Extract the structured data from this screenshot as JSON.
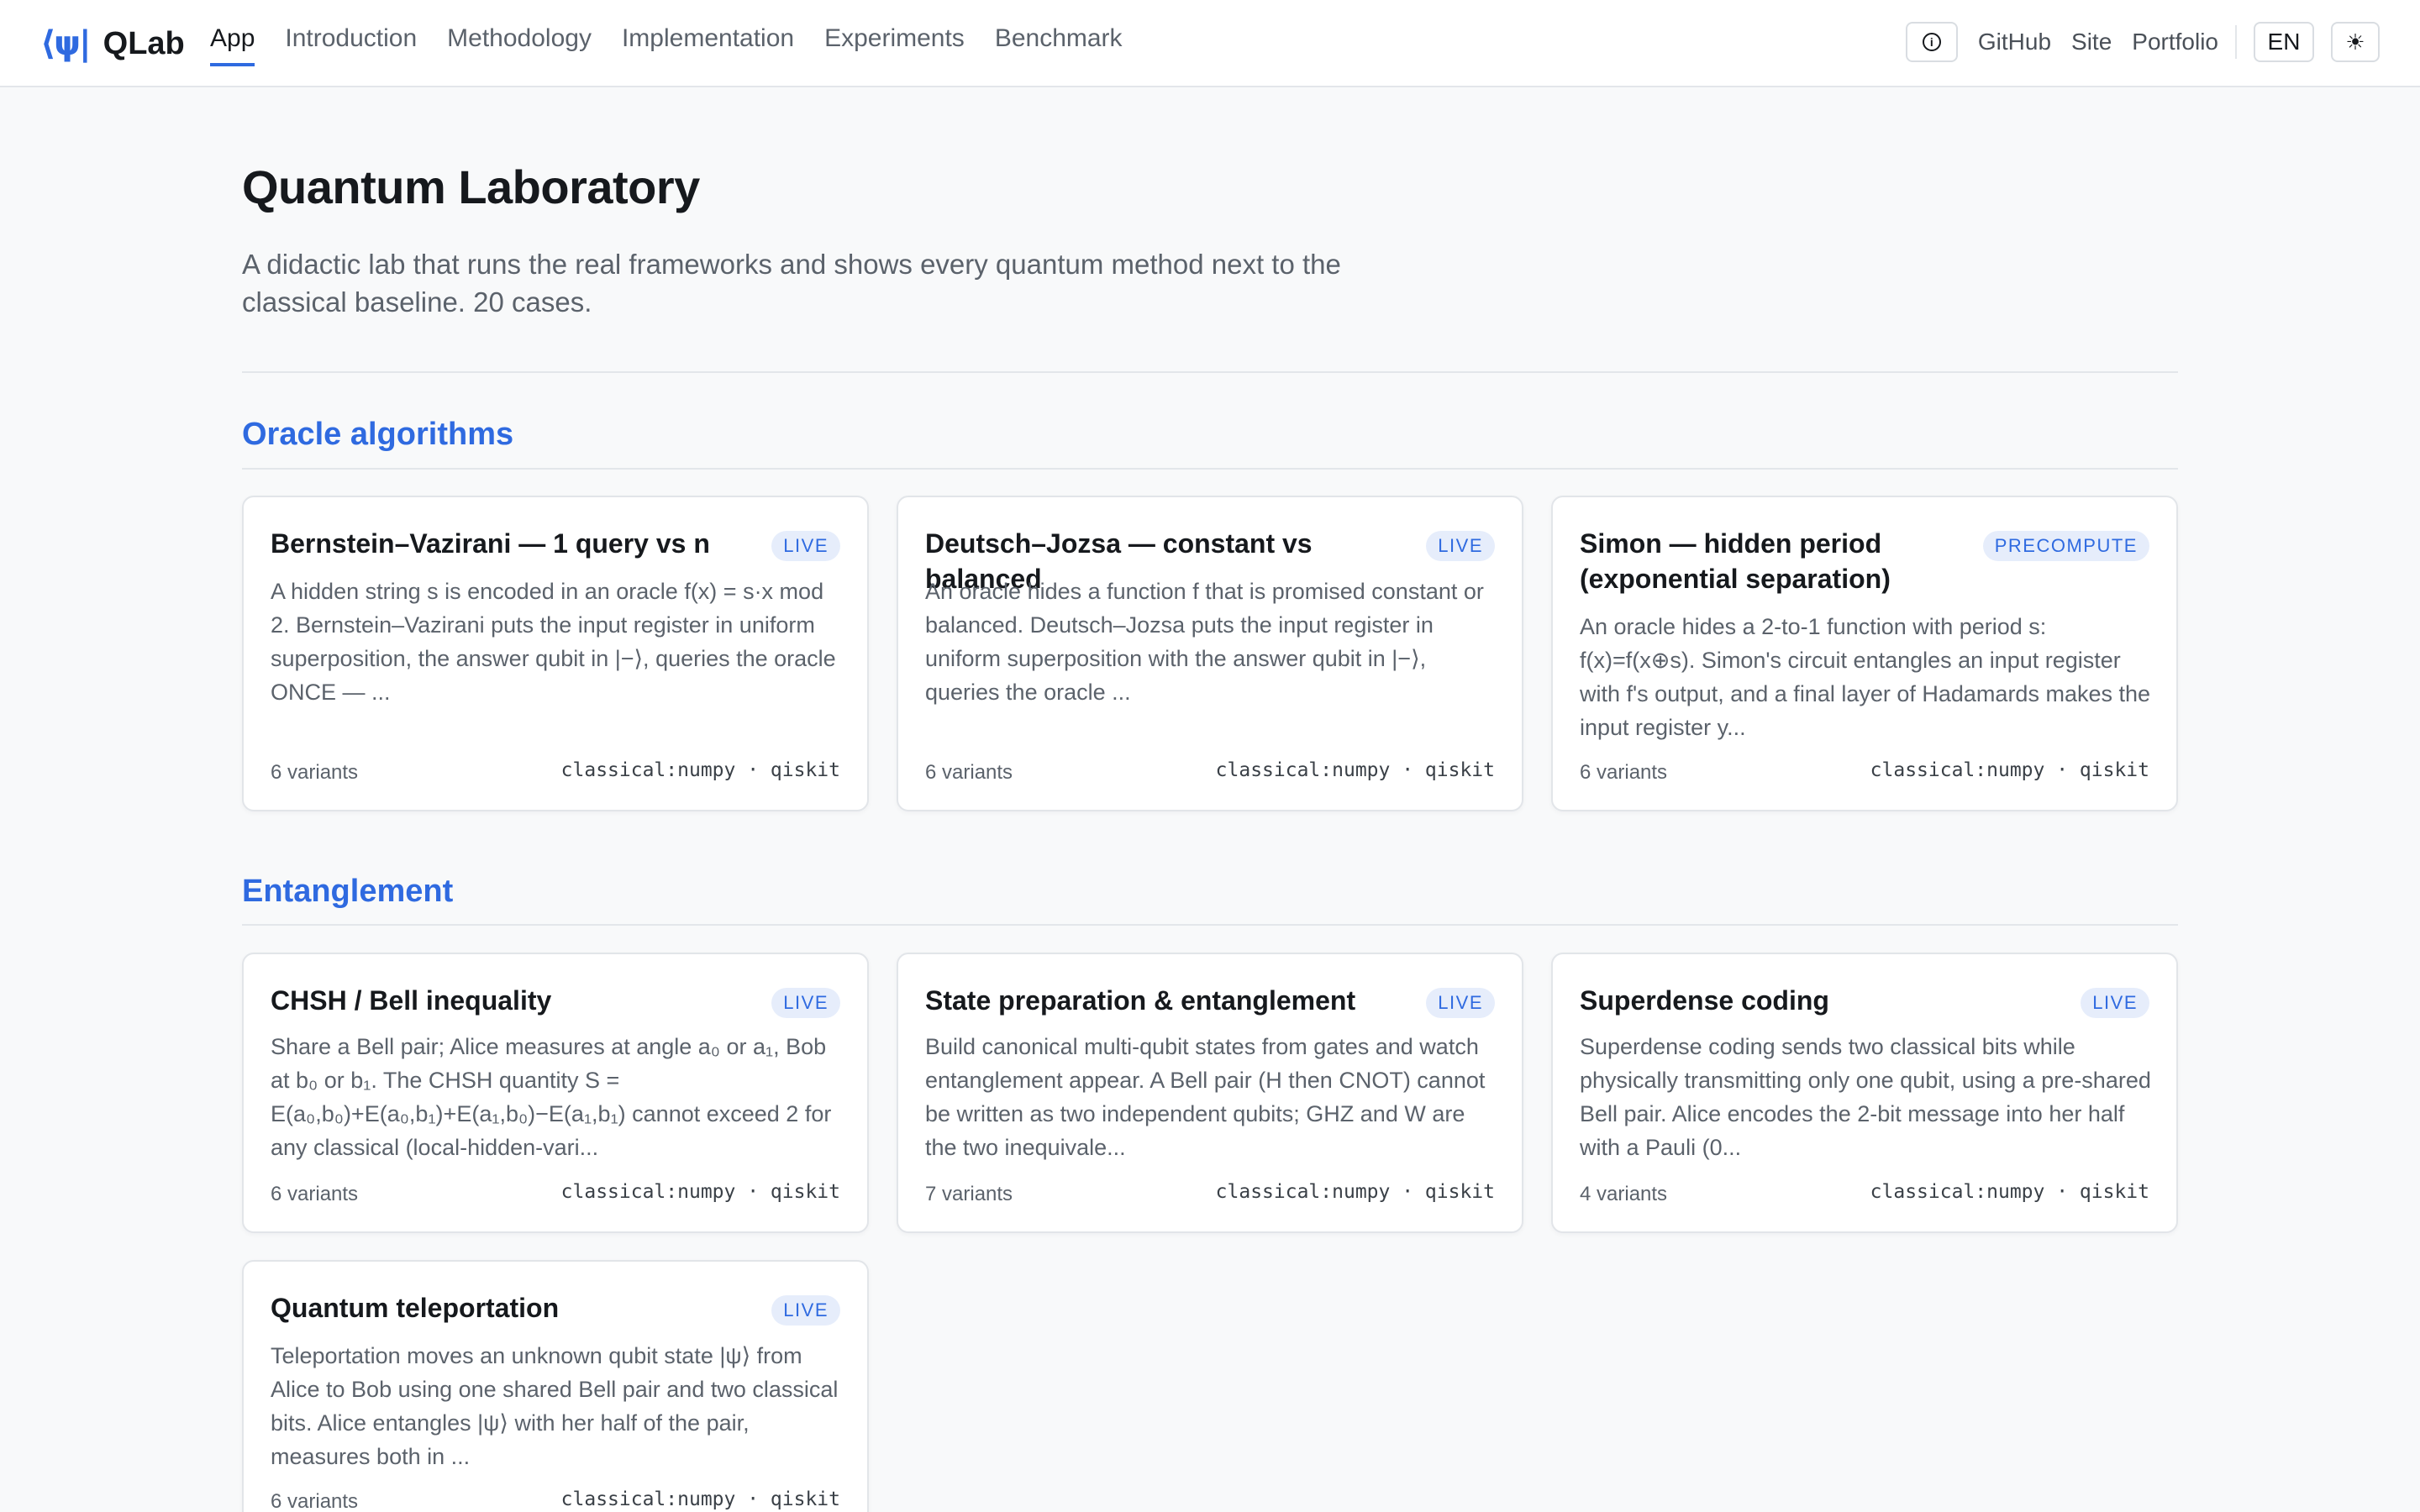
{
  "nav": {
    "brand_mark": "⟨ψ|",
    "brand_name": "QLab",
    "links": [
      "App",
      "Introduction",
      "Methodology",
      "Implementation",
      "Experiments",
      "Benchmark"
    ],
    "info_icon": "info-icon",
    "external_links": [
      "GitHub",
      "Site",
      "Portfolio"
    ],
    "lang": "EN",
    "theme_icon": "☀"
  },
  "header": {
    "title": "Quantum Laboratory",
    "subtitle": "A didactic lab that runs the real frameworks and shows every quantum method next to the classical baseline. 20 cases."
  },
  "sections": [
    {
      "title": "Oracle algorithms",
      "cards": [
        {
          "title": "Bernstein–Vazirani — 1 query vs n",
          "badge": "LIVE",
          "description": "A hidden string s is encoded in an oracle f(x) = s·x mod 2. Bernstein–Vazirani puts the input register in uniform superposition, the answer qubit in |−⟩, queries the oracle ONCE — ...",
          "variants": "6 variants",
          "tags": "classical:numpy · qiskit"
        },
        {
          "title": "Deutsch–Jozsa — constant vs balanced",
          "badge": "LIVE",
          "description": "An oracle hides a function f that is promised constant or balanced. Deutsch–Jozsa puts the input register in uniform superposition with the answer qubit in |−⟩, queries the oracle ...",
          "variants": "6 variants",
          "tags": "classical:numpy · qiskit"
        },
        {
          "title": "Simon — hidden period (exponential separation)",
          "badge": "PRECOMPUTE",
          "description": "An oracle hides a 2-to-1 function with period s: f(x)=f(x⊕s). Simon's circuit entangles an input register with f's output, and a final layer of Hadamards makes the input register y...",
          "variants": "6 variants",
          "tags": "classical:numpy · qiskit"
        }
      ]
    },
    {
      "title": "Entanglement",
      "cards": [
        {
          "title": "CHSH / Bell inequality",
          "badge": "LIVE",
          "description": "Share a Bell pair; Alice measures at angle a₀ or a₁, Bob at b₀ or b₁. The CHSH quantity S = E(a₀,b₀)+E(a₀,b₁)+E(a₁,b₀)−E(a₁,b₁) cannot exceed 2 for any classical (local-hidden-vari...",
          "variants": "6 variants",
          "tags": "classical:numpy · qiskit"
        },
        {
          "title": "State preparation & entanglement",
          "badge": "LIVE",
          "description": "Build canonical multi-qubit states from gates and watch entanglement appear. A Bell pair (H then CNOT) cannot be written as two independent qubits; GHZ and W are the two inequivale...",
          "variants": "7 variants",
          "tags": "classical:numpy · qiskit"
        },
        {
          "title": "Superdense coding",
          "badge": "LIVE",
          "description": "Superdense coding sends two classical bits while physically transmitting only one qubit, using a pre-shared Bell pair. Alice encodes the 2-bit message into her half with a Pauli (0...",
          "variants": "4 variants",
          "tags": "classical:numpy · qiskit"
        },
        {
          "title": "Quantum teleportation",
          "badge": "LIVE",
          "description": "Teleportation moves an unknown qubit state |ψ⟩ from Alice to Bob using one shared Bell pair and two classical bits. Alice entangles |ψ⟩ with her half of the pair, measures both in ...",
          "variants": "6 variants",
          "tags": "classical:numpy · qiskit"
        }
      ]
    }
  ]
}
